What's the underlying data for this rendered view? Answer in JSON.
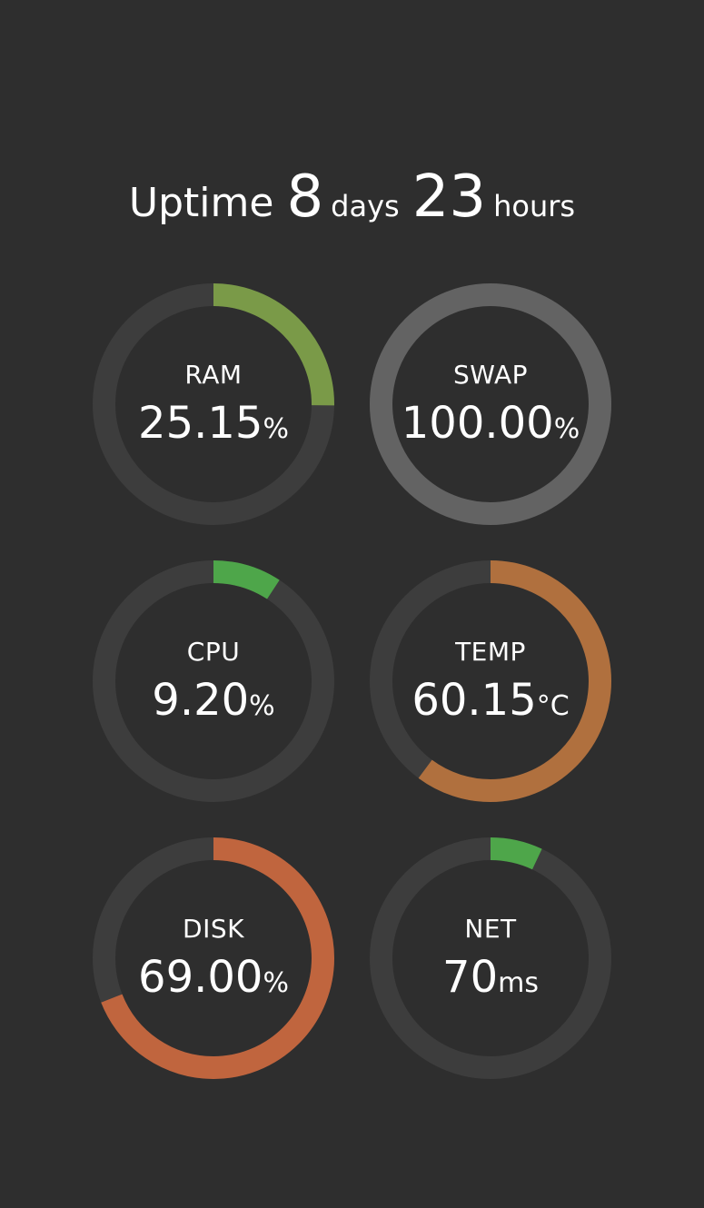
{
  "uptime": {
    "label": "Uptime",
    "days_value": "8",
    "days_unit": "days",
    "hours_value": "23",
    "hours_unit": "hours"
  },
  "colors": {
    "background": "#2e2e2e",
    "track": "#3d3d3d",
    "text": "#ffffff"
  },
  "gauges": [
    {
      "id": "ram",
      "label": "RAM",
      "value": "25.15",
      "unit": "%",
      "fraction": 0.2515,
      "color": "#7a9a48",
      "track": "#3d3d3d"
    },
    {
      "id": "swap",
      "label": "SWAP",
      "value": "100.00",
      "unit": "%",
      "fraction": 1.0,
      "color": "#636363",
      "track": "#3d3d3d"
    },
    {
      "id": "cpu",
      "label": "CPU",
      "value": "9.20",
      "unit": "%",
      "fraction": 0.092,
      "color": "#4ea64a",
      "track": "#3d3d3d"
    },
    {
      "id": "temp",
      "label": "TEMP",
      "value": "60.15",
      "unit": "°C",
      "fraction": 0.6015,
      "color": "#b0703e",
      "track": "#3d3d3d"
    },
    {
      "id": "disk",
      "label": "DISK",
      "value": "69.00",
      "unit": "%",
      "fraction": 0.69,
      "color": "#c0653e",
      "track": "#3d3d3d"
    },
    {
      "id": "net",
      "label": "NET",
      "value": "70",
      "unit": "ms",
      "fraction": 0.07,
      "color": "#4ea64a",
      "track": "#3d3d3d"
    }
  ]
}
